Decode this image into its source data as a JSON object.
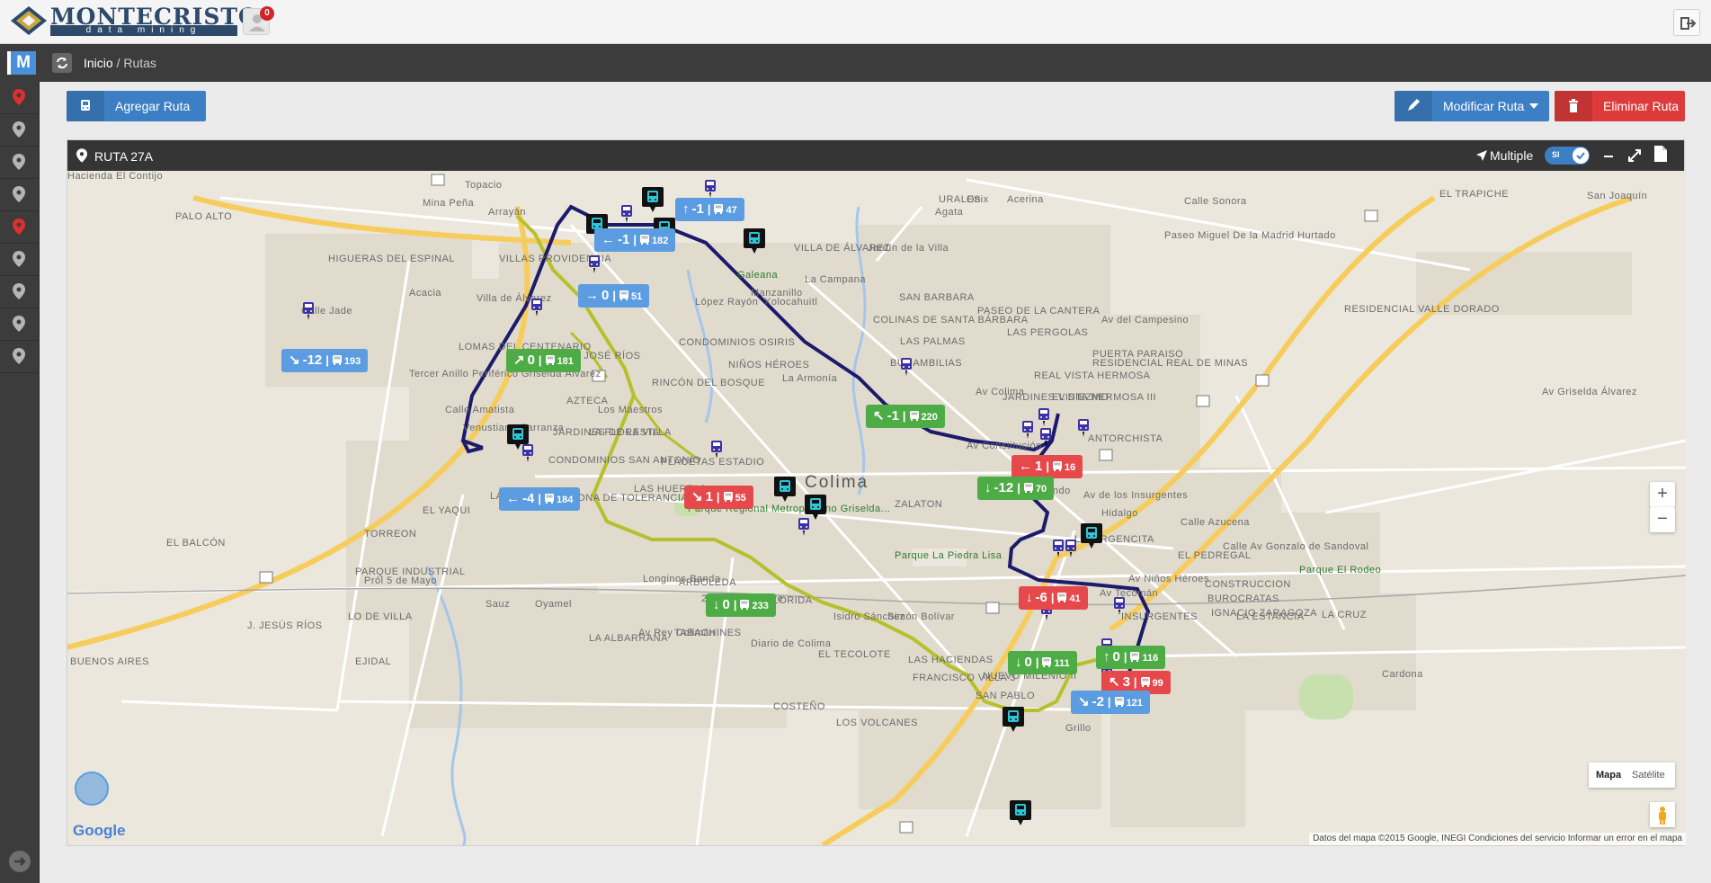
{
  "header": {
    "brand": "MONTECRISTO",
    "brand_sub": "data mining",
    "notifications": "0"
  },
  "crumbs": {
    "menu_letter": "M",
    "home": "Inicio",
    "separator": "/",
    "current": "Rutas"
  },
  "sidebar": {
    "items": [
      {
        "icon": "map-marker-icon",
        "active": true
      },
      {
        "icon": "map-marker-icon",
        "active": false
      },
      {
        "icon": "map-marker-icon",
        "active": false
      },
      {
        "icon": "map-marker-icon",
        "active": false
      },
      {
        "icon": "map-marker-icon",
        "active": true
      },
      {
        "icon": "map-marker-icon",
        "active": false
      },
      {
        "icon": "map-marker-icon",
        "active": false
      },
      {
        "icon": "map-marker-icon",
        "active": false
      },
      {
        "icon": "map-marker-icon",
        "active": false
      }
    ]
  },
  "toolbar": {
    "add_label": "Agregar Ruta",
    "modify_label": "Modificar Ruta",
    "delete_label": "Eliminar Ruta"
  },
  "panel": {
    "title": "RUTA 27A",
    "multiple_label": "Multiple",
    "toggle_label": "SI",
    "toggle_on": true
  },
  "map": {
    "labels": [
      "Mina Peña",
      "PALO ALTO",
      "HIGUERAS DEL ESPINAL",
      "VILLAS PROVIDENCIA",
      "Villa de Álvarez",
      "LOMAS DEL CENTENARIO",
      "JUAN JOSÉ RÍOS",
      "AZTECA",
      "JARDINES DE LA VILLA",
      "LA FLORESTA",
      "CONDOMINIOS SAN ANTONIO",
      "PLACETAS ESTADIO",
      "LAS HUERTAS",
      "ZONA DE TOLERANCIA",
      "LA TAPATIA",
      "EL YAQUI",
      "TORREON",
      "EL BALCÓN",
      "PARQUE INDUSTRIAL",
      "Sauz",
      "Oyamel",
      "J. JESÚS RÍOS",
      "LO DE VILLA",
      "LA ALBARRANA",
      "TABACHINES",
      "BUENOS AIRES",
      "EJIDAL",
      "Colima",
      "Parque Regional Metropolitano Griselda...",
      "ARBOLEDA",
      "LA FLORIDA",
      "Diario de Colima",
      "EL TECOLOTE",
      "LAS HACIENDAS",
      "FRANCISCO VILLA 3",
      "COSTEÑO",
      "LOS VOLCANES",
      "NUEVO MILENIO II",
      "Parque La Piedra Lisa",
      "ZALATON",
      "SAN PABLO",
      "La Armonía",
      "NIÑOS HÉROES",
      "CONDOMINIOS OSIRIS",
      "RINCÓN DEL BOSQUE",
      "VILLA DE ÁLVAREZ",
      "La Campana",
      "SAN BARBARA",
      "COLINAS DE SANTA BÁRBARA",
      "LAS PALMAS",
      "BUGAMBILIAS",
      "PASEO DE LA CANTERA",
      "LAS PERGOLAS",
      "REAL VISTA HERMOSA",
      "JARDINES VISTA HERMOSA III",
      "EL DIEZMO",
      "RESIDENCIAL REAL DE MINAS",
      "PUERTA PARAISO",
      "RESIDENCIAL VALLE DORADO",
      "ANTORCHISTA",
      "EL TRAPICHE",
      "San Joaquín",
      "LA VIRGENCITA",
      "EL PEDREGAL",
      "CONSTRUCCION",
      "BUROCRATAS",
      "LA ESTANCIA",
      "IGNACIO ZARAGOZA",
      "LA CRUZ",
      "INSURGENTES",
      "Parque El Rodeo",
      "Cardona",
      "Grillo",
      "Av Griselda Álvarez",
      "Calle Azucena",
      "Calle Av Gonzalo de Sandoval",
      "Av Niños Héroes",
      "Longinos Banda",
      "20 de Noviembre",
      "Av Rey Colimán",
      "Isidro Sánchez",
      "Simón Bolívar",
      "Av del Campesino",
      "Paseo Miguel De la Madrid Hurtado",
      "Av Constitución",
      "San Fernando",
      "Av de los Insurgentes",
      "Av Colima",
      "Los Maestros",
      "Pról 5 de Mayo",
      "Hidalgo",
      "Av Tecomán",
      "Calle Sonora",
      "URALES",
      "Onix",
      "Agata",
      "Acerina",
      "Calle Jade",
      "Acacia",
      "Topacio",
      "Arrayán",
      "Xolocahuitl",
      "Manzanillo",
      "Galeana",
      "López Rayón",
      "Jardín de la Villa",
      "Venustiano Carranza",
      "Tercer Anillo Periférico Griselda Álvarez",
      "Calle Amatista",
      "Hacienda El Contijo"
    ],
    "markers": [
      {
        "dir": "↘",
        "delta": "-12",
        "count": "193",
        "color": "blue"
      },
      {
        "dir": "↗",
        "delta": "0",
        "count": "181",
        "color": "green"
      },
      {
        "dir": "←",
        "delta": "-1",
        "count": "182",
        "color": "blue"
      },
      {
        "dir": "↑",
        "delta": "-1",
        "count": "47",
        "color": "blue"
      },
      {
        "dir": "→",
        "delta": "0",
        "count": "51",
        "color": "blue"
      },
      {
        "dir": "↖",
        "delta": "-1",
        "count": "220",
        "color": "green"
      },
      {
        "dir": "←",
        "delta": "1",
        "count": "16",
        "color": "red"
      },
      {
        "dir": "↓",
        "delta": "-12",
        "count": "70",
        "color": "green"
      },
      {
        "dir": "←",
        "delta": "-4",
        "count": "184",
        "color": "blue"
      },
      {
        "dir": "↘",
        "delta": "1",
        "count": "55",
        "color": "red"
      },
      {
        "dir": "↓",
        "delta": "0",
        "count": "233",
        "color": "green"
      },
      {
        "dir": "↓",
        "delta": "-6",
        "count": "41",
        "color": "red"
      },
      {
        "dir": "↓",
        "delta": "0",
        "count": "111",
        "color": "green"
      },
      {
        "dir": "↑",
        "delta": "0",
        "count": "116",
        "color": "green"
      },
      {
        "dir": "↖",
        "delta": "3",
        "count": "99",
        "color": "red"
      },
      {
        "dir": "↘",
        "delta": "-2",
        "count": "121",
        "color": "blue"
      }
    ],
    "zoom_in": "+",
    "zoom_out": "−",
    "type_map": "Mapa",
    "type_satellite": "Satélite",
    "google": "Google",
    "attribution": "Datos del mapa ©2015 Google, INEGI    Condiciones del servicio    Informar un error en el mapa",
    "route_colors": {
      "primary": "#1c1a6b",
      "secondary": "#b7c02c"
    }
  },
  "colors": {
    "accent": "#3d7fc4",
    "danger": "#dd3b3b",
    "success": "#4eac46",
    "dark": "#3c3c3c"
  }
}
